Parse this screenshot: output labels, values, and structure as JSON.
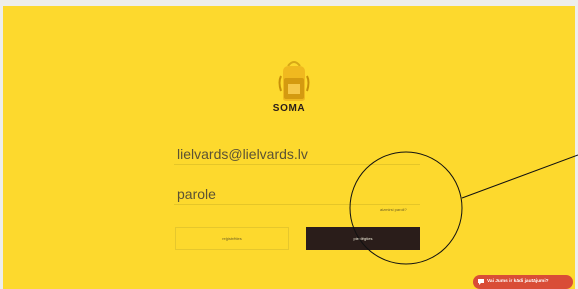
{
  "brand": {
    "name": "SOMA"
  },
  "login_form": {
    "email_value": "lielvards@lielvards.lv",
    "password_placeholder": "parole",
    "forgot_password": "aizmirsi paroli?",
    "register_label": "reģistrēties",
    "login_label": "pieslēgties"
  },
  "chat_widget": {
    "label": "Vai Jums ir kādi jautājumi?"
  },
  "colors": {
    "background": "#fdd92d",
    "primary_dark": "#2a1d1a",
    "chat_accent": "#d94d37"
  }
}
